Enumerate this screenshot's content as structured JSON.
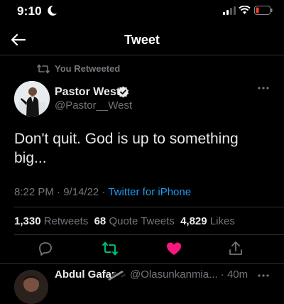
{
  "status_bar": {
    "time": "9:10"
  },
  "header": {
    "title": "Tweet"
  },
  "retweet_banner": {
    "label": "You Retweeted"
  },
  "author": {
    "name": "Pastor West",
    "handle": "@Pastor__West"
  },
  "tweet": {
    "text": "Don't quit. God is up to something big...",
    "time": "8:22 PM",
    "date": "9/14/22",
    "separator": "·",
    "source": "Twitter for iPhone"
  },
  "stats": {
    "retweets_count": "1,330",
    "retweets_label": "Retweets",
    "quotes_count": "68",
    "quotes_label": "Quote Tweets",
    "likes_count": "4,829",
    "likes_label": "Likes"
  },
  "actions": {
    "icons": [
      "reply-icon",
      "retweet-icon",
      "like-icon",
      "share-icon"
    ],
    "retweet_active_color": "#00ba7c",
    "like_active_color": "#f91880"
  },
  "next_reply": {
    "name": "Abdul Gafar",
    "handle": "@Olasunkanmia...",
    "separator": "·",
    "age": "40m"
  },
  "colors": {
    "background": "#000000",
    "text_primary": "#e7e9ea",
    "text_secondary": "#71767b",
    "accent": "#1d9bf0"
  }
}
